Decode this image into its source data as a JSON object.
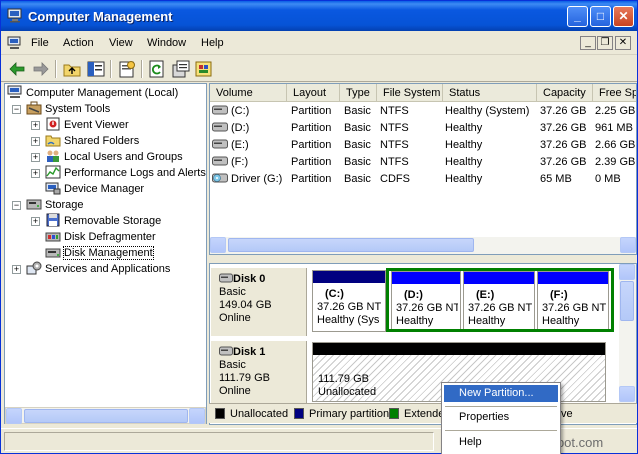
{
  "window": {
    "title": "Computer Management",
    "buttons": {
      "minimize": "_",
      "maximize": "□",
      "close": "✕"
    }
  },
  "menubar": {
    "items": [
      "File",
      "Action",
      "View",
      "Window",
      "Help"
    ],
    "mdi": {
      "minimize": "_",
      "restore": "❐",
      "close": "✕"
    }
  },
  "toolbar": {
    "icons": [
      "back-arrow-icon",
      "forward-arrow-icon",
      "up-folder-icon",
      "show-hide-tree-icon",
      "properties-icon",
      "refresh-icon",
      "export-list-icon",
      "help-icon"
    ]
  },
  "tree": {
    "items": [
      {
        "label": "Computer Management (Local)",
        "icon": "computer-management-icon",
        "level": 0
      },
      {
        "label": "System Tools",
        "icon": "system-tools-icon",
        "level": 1,
        "expander": "−"
      },
      {
        "label": "Event Viewer",
        "icon": "event-viewer-icon",
        "level": 2,
        "expander": "+"
      },
      {
        "label": "Shared Folders",
        "icon": "shared-folders-icon",
        "level": 2,
        "expander": "+"
      },
      {
        "label": "Local Users and Groups",
        "icon": "users-icon",
        "level": 2,
        "expander": "+"
      },
      {
        "label": "Performance Logs and Alerts",
        "icon": "performance-icon",
        "level": 2,
        "expander": "+"
      },
      {
        "label": "Device Manager",
        "icon": "device-manager-icon",
        "level": 2
      },
      {
        "label": "Storage",
        "icon": "storage-icon",
        "level": 1,
        "expander": "−"
      },
      {
        "label": "Removable Storage",
        "icon": "removable-storage-icon",
        "level": 2,
        "expander": "+"
      },
      {
        "label": "Disk Defragmenter",
        "icon": "defragmenter-icon",
        "level": 2
      },
      {
        "label": "Disk Management",
        "icon": "disk-management-icon",
        "level": 2,
        "selected": true
      },
      {
        "label": "Services and Applications",
        "icon": "services-icon",
        "level": 1,
        "expander": "+"
      }
    ]
  },
  "volumes": {
    "columns": [
      "Volume",
      "Layout",
      "Type",
      "File System",
      "Status",
      "Capacity",
      "Free Sp"
    ],
    "rows": [
      {
        "volume": "(C:)",
        "layout": "Partition",
        "type": "Basic",
        "fs": "NTFS",
        "status": "Healthy (System)",
        "capacity": "37.26 GB",
        "free": "2.25 GB",
        "icon": "drive-icon"
      },
      {
        "volume": "(D:)",
        "layout": "Partition",
        "type": "Basic",
        "fs": "NTFS",
        "status": "Healthy",
        "capacity": "37.26 GB",
        "free": "961 MB",
        "icon": "drive-icon"
      },
      {
        "volume": "(E:)",
        "layout": "Partition",
        "type": "Basic",
        "fs": "NTFS",
        "status": "Healthy",
        "capacity": "37.26 GB",
        "free": "2.66 GB",
        "icon": "drive-icon"
      },
      {
        "volume": "(F:)",
        "layout": "Partition",
        "type": "Basic",
        "fs": "NTFS",
        "status": "Healthy",
        "capacity": "37.26 GB",
        "free": "2.39 GB",
        "icon": "drive-icon"
      },
      {
        "volume": "Driver (G:)",
        "layout": "Partition",
        "type": "Basic",
        "fs": "CDFS",
        "status": "Healthy",
        "capacity": "65 MB",
        "free": "0 MB",
        "icon": "cd-drive-icon"
      }
    ]
  },
  "disks": [
    {
      "name": "Disk 0",
      "type": "Basic",
      "size": "149.04 GB",
      "state": "Online",
      "partitions": [
        {
          "name": "(C:)",
          "size": "37.26 GB NT",
          "status": "Healthy (Sys"
        },
        {
          "name": "(D:)",
          "size": "37.26 GB NT",
          "status": "Healthy"
        },
        {
          "name": "(E:)",
          "size": "37.26 GB NT",
          "status": "Healthy"
        },
        {
          "name": "(F:)",
          "size": "37.26 GB NT",
          "status": "Healthy"
        }
      ]
    },
    {
      "name": "Disk 1",
      "type": "Basic",
      "size": "111.79 GB",
      "state": "Online",
      "unallocated": {
        "size": "111.79 GB",
        "label": "Unallocated"
      }
    }
  ],
  "legend": [
    {
      "label": "Unallocated",
      "color": "#000000"
    },
    {
      "label": "Primary partition",
      "color": "#000080"
    },
    {
      "label": "Extende",
      "color": "#008000"
    },
    {
      "label": "ve",
      "color": ""
    }
  ],
  "context_menu": {
    "items": [
      "New Partition...",
      "Properties",
      "Help"
    ],
    "highlighted": "New Partition..."
  },
  "watermark": "sohastech.blogspot.com",
  "colors": {
    "titlebar": "#0653d6",
    "primary": "#0000ff",
    "extended": "#008000",
    "highlight": "#316ac5"
  }
}
